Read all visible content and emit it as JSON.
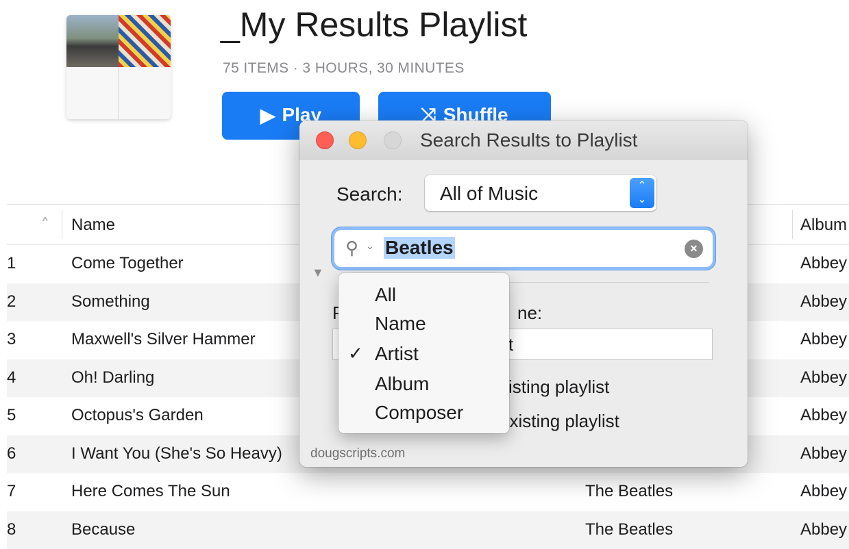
{
  "playlist": {
    "title": "_My Results Playlist",
    "subtitle": "75 ITEMS · 3 HOURS, 30 MINUTES",
    "play_label": "Play",
    "shuffle_label": "Shuffle"
  },
  "table": {
    "columns": {
      "name": "Name",
      "album": "Album"
    },
    "rows": [
      {
        "num": "1",
        "name": "Come Together",
        "artist": "",
        "album": "Abbey Road"
      },
      {
        "num": "2",
        "name": "Something",
        "artist": "",
        "album": "Abbey Road"
      },
      {
        "num": "3",
        "name": "Maxwell's Silver Hammer",
        "artist": "",
        "album": "Abbey Road"
      },
      {
        "num": "4",
        "name": "Oh! Darling",
        "artist": "",
        "album": "Abbey Road"
      },
      {
        "num": "5",
        "name": "Octopus's Garden",
        "artist": "",
        "album": "Abbey Road"
      },
      {
        "num": "6",
        "name": "I Want You (She's So Heavy)",
        "artist": "",
        "album": "Abbey Road"
      },
      {
        "num": "7",
        "name": "Here Comes The Sun",
        "artist": "The Beatles",
        "album": "Abbey Road"
      },
      {
        "num": "8",
        "name": "Because",
        "artist": "The Beatles",
        "album": "Abbey Road"
      }
    ]
  },
  "dialog": {
    "title": "Search Results to Playlist",
    "search_label": "Search:",
    "search_scope": "All of Music",
    "search_text": "Beatles",
    "playlist_label_start": "P",
    "playlist_label_end": "ne:",
    "playlist_name_fragment": "t",
    "option_new_fragment": "xisting playlist",
    "option_existing_fragment": "existing playlist",
    "credit": "dougscripts.com"
  },
  "menu": {
    "items": [
      "All",
      "Name",
      "Artist",
      "Album",
      "Composer"
    ],
    "checked": "Artist"
  },
  "colors": {
    "accent": "#1a7cf5",
    "row_alt": "#f3f3f3",
    "dialog_bg": "#ececec"
  }
}
